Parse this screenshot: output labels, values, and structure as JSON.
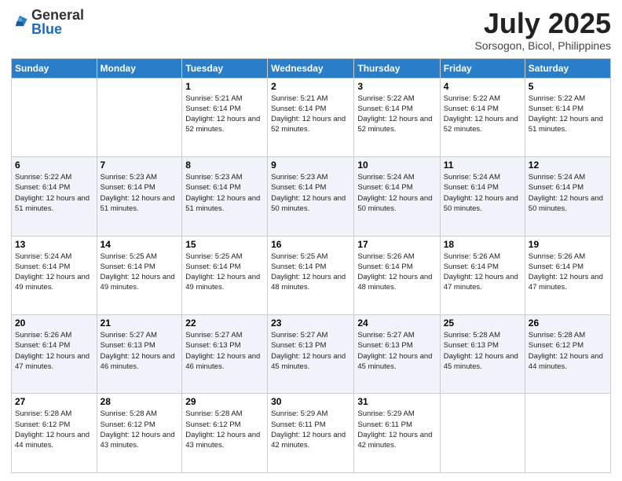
{
  "header": {
    "logo": {
      "general": "General",
      "blue": "Blue"
    },
    "title": "July 2025",
    "subtitle": "Sorsogon, Bicol, Philippines"
  },
  "weekdays": [
    "Sunday",
    "Monday",
    "Tuesday",
    "Wednesday",
    "Thursday",
    "Friday",
    "Saturday"
  ],
  "weeks": [
    [
      {
        "day": "",
        "sunrise": "",
        "sunset": "",
        "daylight": ""
      },
      {
        "day": "",
        "sunrise": "",
        "sunset": "",
        "daylight": ""
      },
      {
        "day": "1",
        "sunrise": "Sunrise: 5:21 AM",
        "sunset": "Sunset: 6:14 PM",
        "daylight": "Daylight: 12 hours and 52 minutes."
      },
      {
        "day": "2",
        "sunrise": "Sunrise: 5:21 AM",
        "sunset": "Sunset: 6:14 PM",
        "daylight": "Daylight: 12 hours and 52 minutes."
      },
      {
        "day": "3",
        "sunrise": "Sunrise: 5:22 AM",
        "sunset": "Sunset: 6:14 PM",
        "daylight": "Daylight: 12 hours and 52 minutes."
      },
      {
        "day": "4",
        "sunrise": "Sunrise: 5:22 AM",
        "sunset": "Sunset: 6:14 PM",
        "daylight": "Daylight: 12 hours and 52 minutes."
      },
      {
        "day": "5",
        "sunrise": "Sunrise: 5:22 AM",
        "sunset": "Sunset: 6:14 PM",
        "daylight": "Daylight: 12 hours and 51 minutes."
      }
    ],
    [
      {
        "day": "6",
        "sunrise": "Sunrise: 5:22 AM",
        "sunset": "Sunset: 6:14 PM",
        "daylight": "Daylight: 12 hours and 51 minutes."
      },
      {
        "day": "7",
        "sunrise": "Sunrise: 5:23 AM",
        "sunset": "Sunset: 6:14 PM",
        "daylight": "Daylight: 12 hours and 51 minutes."
      },
      {
        "day": "8",
        "sunrise": "Sunrise: 5:23 AM",
        "sunset": "Sunset: 6:14 PM",
        "daylight": "Daylight: 12 hours and 51 minutes."
      },
      {
        "day": "9",
        "sunrise": "Sunrise: 5:23 AM",
        "sunset": "Sunset: 6:14 PM",
        "daylight": "Daylight: 12 hours and 50 minutes."
      },
      {
        "day": "10",
        "sunrise": "Sunrise: 5:24 AM",
        "sunset": "Sunset: 6:14 PM",
        "daylight": "Daylight: 12 hours and 50 minutes."
      },
      {
        "day": "11",
        "sunrise": "Sunrise: 5:24 AM",
        "sunset": "Sunset: 6:14 PM",
        "daylight": "Daylight: 12 hours and 50 minutes."
      },
      {
        "day": "12",
        "sunrise": "Sunrise: 5:24 AM",
        "sunset": "Sunset: 6:14 PM",
        "daylight": "Daylight: 12 hours and 50 minutes."
      }
    ],
    [
      {
        "day": "13",
        "sunrise": "Sunrise: 5:24 AM",
        "sunset": "Sunset: 6:14 PM",
        "daylight": "Daylight: 12 hours and 49 minutes."
      },
      {
        "day": "14",
        "sunrise": "Sunrise: 5:25 AM",
        "sunset": "Sunset: 6:14 PM",
        "daylight": "Daylight: 12 hours and 49 minutes."
      },
      {
        "day": "15",
        "sunrise": "Sunrise: 5:25 AM",
        "sunset": "Sunset: 6:14 PM",
        "daylight": "Daylight: 12 hours and 49 minutes."
      },
      {
        "day": "16",
        "sunrise": "Sunrise: 5:25 AM",
        "sunset": "Sunset: 6:14 PM",
        "daylight": "Daylight: 12 hours and 48 minutes."
      },
      {
        "day": "17",
        "sunrise": "Sunrise: 5:26 AM",
        "sunset": "Sunset: 6:14 PM",
        "daylight": "Daylight: 12 hours and 48 minutes."
      },
      {
        "day": "18",
        "sunrise": "Sunrise: 5:26 AM",
        "sunset": "Sunset: 6:14 PM",
        "daylight": "Daylight: 12 hours and 47 minutes."
      },
      {
        "day": "19",
        "sunrise": "Sunrise: 5:26 AM",
        "sunset": "Sunset: 6:14 PM",
        "daylight": "Daylight: 12 hours and 47 minutes."
      }
    ],
    [
      {
        "day": "20",
        "sunrise": "Sunrise: 5:26 AM",
        "sunset": "Sunset: 6:14 PM",
        "daylight": "Daylight: 12 hours and 47 minutes."
      },
      {
        "day": "21",
        "sunrise": "Sunrise: 5:27 AM",
        "sunset": "Sunset: 6:13 PM",
        "daylight": "Daylight: 12 hours and 46 minutes."
      },
      {
        "day": "22",
        "sunrise": "Sunrise: 5:27 AM",
        "sunset": "Sunset: 6:13 PM",
        "daylight": "Daylight: 12 hours and 46 minutes."
      },
      {
        "day": "23",
        "sunrise": "Sunrise: 5:27 AM",
        "sunset": "Sunset: 6:13 PM",
        "daylight": "Daylight: 12 hours and 45 minutes."
      },
      {
        "day": "24",
        "sunrise": "Sunrise: 5:27 AM",
        "sunset": "Sunset: 6:13 PM",
        "daylight": "Daylight: 12 hours and 45 minutes."
      },
      {
        "day": "25",
        "sunrise": "Sunrise: 5:28 AM",
        "sunset": "Sunset: 6:13 PM",
        "daylight": "Daylight: 12 hours and 45 minutes."
      },
      {
        "day": "26",
        "sunrise": "Sunrise: 5:28 AM",
        "sunset": "Sunset: 6:12 PM",
        "daylight": "Daylight: 12 hours and 44 minutes."
      }
    ],
    [
      {
        "day": "27",
        "sunrise": "Sunrise: 5:28 AM",
        "sunset": "Sunset: 6:12 PM",
        "daylight": "Daylight: 12 hours and 44 minutes."
      },
      {
        "day": "28",
        "sunrise": "Sunrise: 5:28 AM",
        "sunset": "Sunset: 6:12 PM",
        "daylight": "Daylight: 12 hours and 43 minutes."
      },
      {
        "day": "29",
        "sunrise": "Sunrise: 5:28 AM",
        "sunset": "Sunset: 6:12 PM",
        "daylight": "Daylight: 12 hours and 43 minutes."
      },
      {
        "day": "30",
        "sunrise": "Sunrise: 5:29 AM",
        "sunset": "Sunset: 6:11 PM",
        "daylight": "Daylight: 12 hours and 42 minutes."
      },
      {
        "day": "31",
        "sunrise": "Sunrise: 5:29 AM",
        "sunset": "Sunset: 6:11 PM",
        "daylight": "Daylight: 12 hours and 42 minutes."
      },
      {
        "day": "",
        "sunrise": "",
        "sunset": "",
        "daylight": ""
      },
      {
        "day": "",
        "sunrise": "",
        "sunset": "",
        "daylight": ""
      }
    ]
  ]
}
